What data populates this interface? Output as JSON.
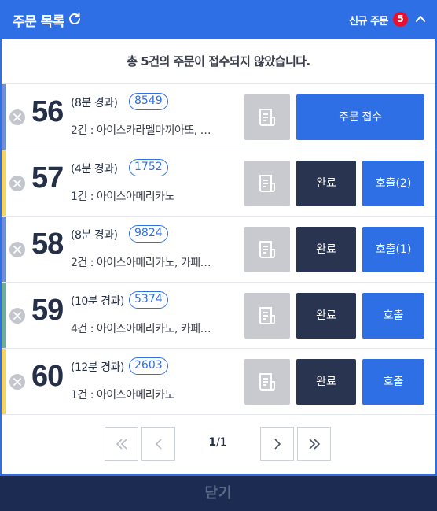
{
  "header": {
    "title": "주문 목록",
    "new_orders_label": "신규 주문",
    "new_orders_count": "5"
  },
  "notice": "총 5건의 주문이 접수되지 않았습니다.",
  "orders": [
    {
      "number": "56",
      "elapsed": "(8분 경과)",
      "code": "8549",
      "items": "2건 : 아이스카라멜마끼아또, …",
      "accent": "#6d8fe0",
      "action": "accept",
      "accept_label": "주문 접수"
    },
    {
      "number": "57",
      "elapsed": "(4분 경과)",
      "code": "1752",
      "items": "1건 : 아이스아메리카노",
      "accent": "#f3d36b",
      "action": "call",
      "done_label": "완료",
      "call_label": "호출(2)"
    },
    {
      "number": "58",
      "elapsed": "(8분 경과)",
      "code": "9824",
      "items": "2건 : 아이스아메리카노, 카페…",
      "accent": "#6d8fe0",
      "action": "call",
      "done_label": "완료",
      "call_label": "호출(1)"
    },
    {
      "number": "59",
      "elapsed": "(10분 경과)",
      "code": "5374",
      "items": "4건 : 아이스아메리카노, 카페…",
      "accent": "#6fae9a",
      "action": "call",
      "done_label": "완료",
      "call_label": "호출"
    },
    {
      "number": "60",
      "elapsed": "(12분 경과)",
      "code": "2603",
      "items": "1건 : 아이스아메리카노",
      "accent": "#f3d36b",
      "action": "call",
      "done_label": "완료",
      "call_label": "호출"
    }
  ],
  "pagination": {
    "current": "1",
    "total": "/1"
  },
  "footer": {
    "close_label": "닫기"
  },
  "colors": {
    "primary": "#2f6fe6",
    "dark": "#293550",
    "badge": "#e8112d",
    "footer": "#1b2b52"
  }
}
